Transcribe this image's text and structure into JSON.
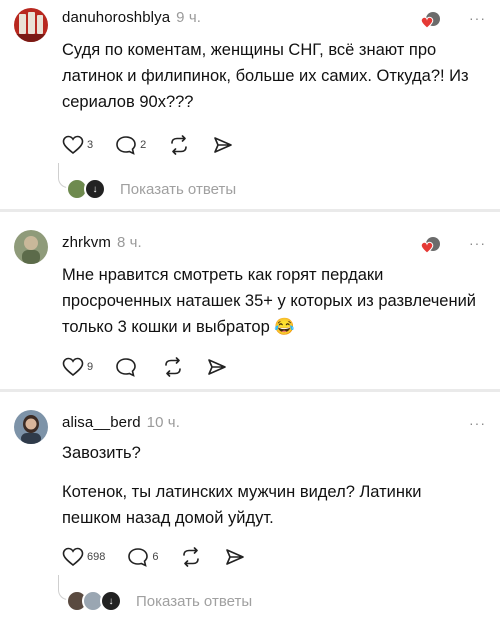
{
  "comments": [
    {
      "username": "danuhoroshblya",
      "time": "9 ч.",
      "text": "Судя по коментам, женщины СНГ,  всё знают про латинок и филипинок, больше их самих. Откуда?! Из сериалов 90х???",
      "likes": "3",
      "replies_count": "2",
      "show_replies_label": "Показать ответы"
    },
    {
      "username": "zhrkvm",
      "time": "8 ч.",
      "text": "Мне нравится смотреть как горят пердаки просроченных наташек 35+ у которых из развлечений только 3 кошки и выбратор 😂",
      "likes": "9",
      "replies_count": ""
    },
    {
      "username": "alisa__berd",
      "time": "10 ч.",
      "text_line1": "Завозить?",
      "text_line2": "Котенок, ты латинских мужчин видел? Латинки пешком назад домой уйдут.",
      "likes": "698",
      "replies_count": "6",
      "show_replies_label": "Показать ответы"
    }
  ],
  "more_glyph": "···",
  "colors": {
    "accent_red": "#e53935",
    "muted": "#9a9a9a"
  }
}
